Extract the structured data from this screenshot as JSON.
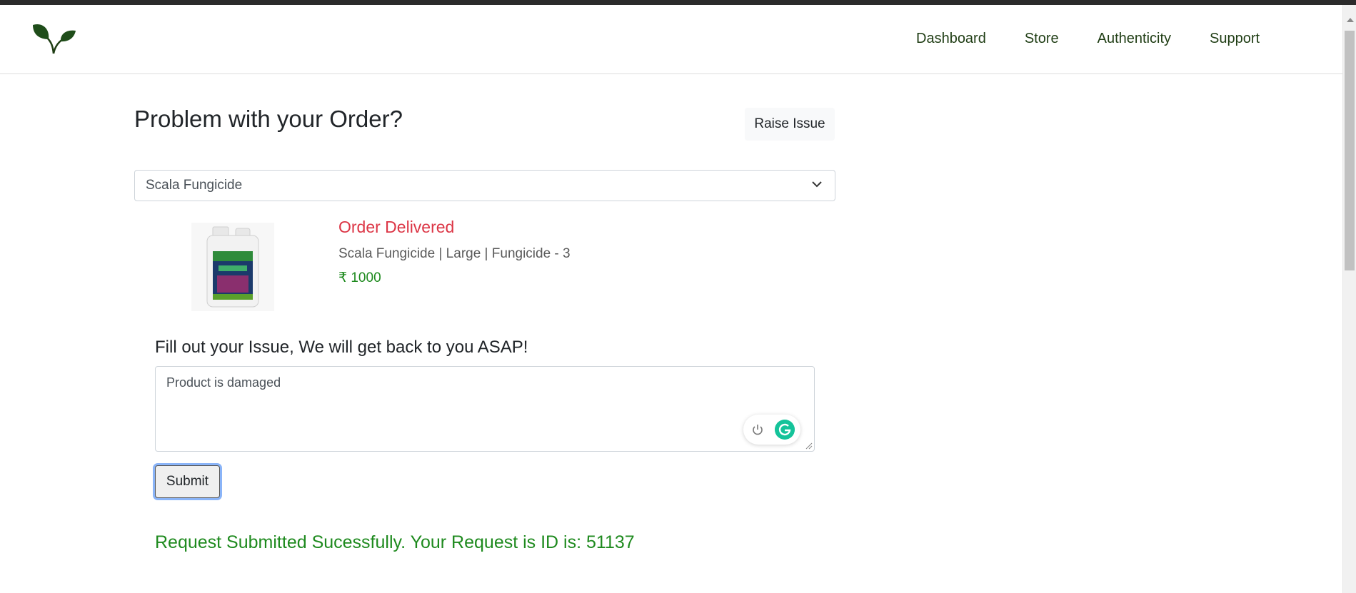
{
  "nav": {
    "links": [
      "Dashboard",
      "Store",
      "Authenticity",
      "Support"
    ]
  },
  "page": {
    "title": "Problem with your Order?",
    "raise_issue_label": "Raise Issue"
  },
  "order_select": {
    "selected": "Scala Fungicide"
  },
  "order": {
    "status": "Order Delivered",
    "description": "Scala Fungicide | Large | Fungicide - 3",
    "price": "₹ 1000"
  },
  "issue_form": {
    "label": "Fill out your Issue, We will get back to you ASAP!",
    "value": "Product is damaged",
    "submit_label": "Submit"
  },
  "confirmation": {
    "message": "Request Submitted Sucessfully. Your Request is ID is: 51137"
  },
  "colors": {
    "brand_green": "#1e8a1e",
    "status_red": "#dc3545",
    "nav_text": "#1f3d14",
    "grammarly": "#15c39a"
  },
  "icons": [
    "leaf-logo-icon",
    "chevron-down-icon",
    "power-icon",
    "grammarly-icon"
  ]
}
